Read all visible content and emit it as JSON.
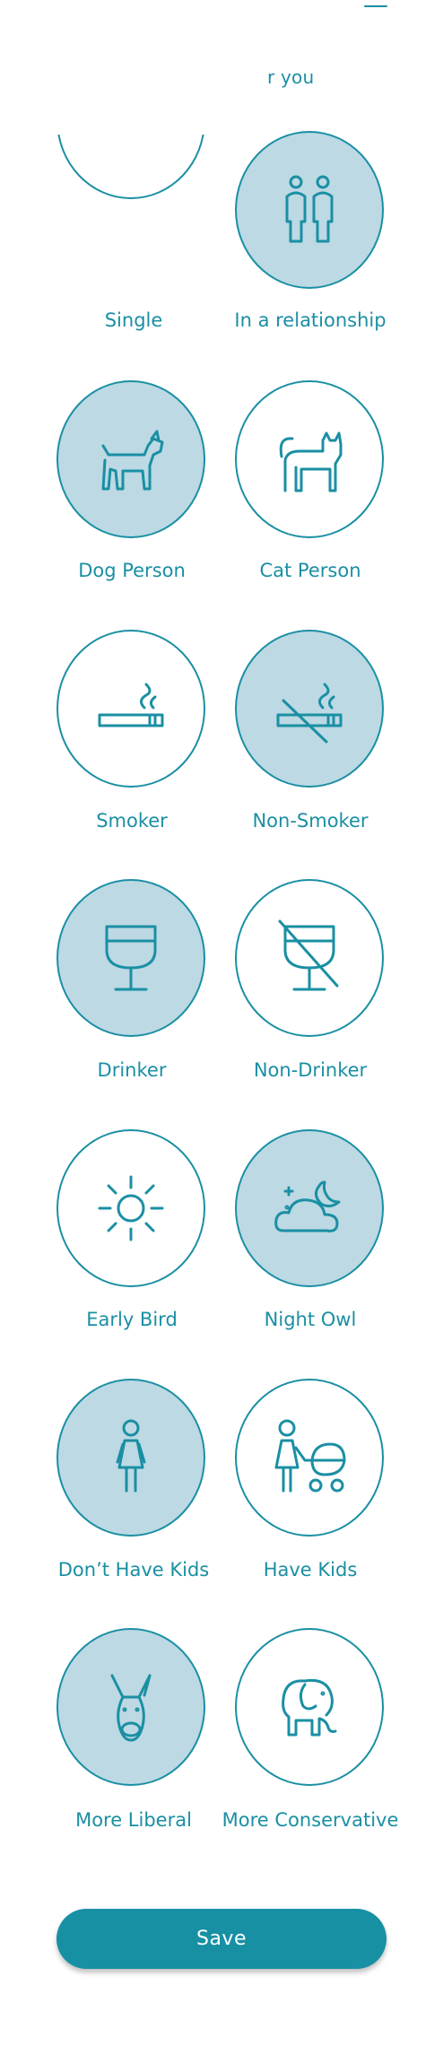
{
  "header": {
    "partial_text": "r you"
  },
  "options": [
    {
      "label": "Single",
      "icon": "single-icon",
      "selected": false
    },
    {
      "label": "In a relationship",
      "icon": "couple-icon",
      "selected": true
    },
    {
      "label": "Dog Person",
      "icon": "dog-icon",
      "selected": true
    },
    {
      "label": "Cat Person",
      "icon": "cat-icon",
      "selected": false
    },
    {
      "label": "Smoker",
      "icon": "cigarette-icon",
      "selected": false
    },
    {
      "label": "Non-Smoker",
      "icon": "no-smoking-icon",
      "selected": true
    },
    {
      "label": "Drinker",
      "icon": "wine-glass-icon",
      "selected": true
    },
    {
      "label": "Non-Drinker",
      "icon": "no-drinking-icon",
      "selected": false
    },
    {
      "label": "Early Bird",
      "icon": "sun-icon",
      "selected": false
    },
    {
      "label": "Night Owl",
      "icon": "moon-cloud-icon",
      "selected": true
    },
    {
      "label": "Don’t Have Kids",
      "icon": "woman-icon",
      "selected": true
    },
    {
      "label": "Have Kids",
      "icon": "woman-stroller-icon",
      "selected": false
    },
    {
      "label": "More Liberal",
      "icon": "donkey-icon",
      "selected": true
    },
    {
      "label": "More Conservative",
      "icon": "elephant-icon",
      "selected": false
    }
  ],
  "save_label": "Save",
  "colors": {
    "accent": "#1a8fa3",
    "selected_fill": "#bcd9e4",
    "button": "#1790a4"
  }
}
